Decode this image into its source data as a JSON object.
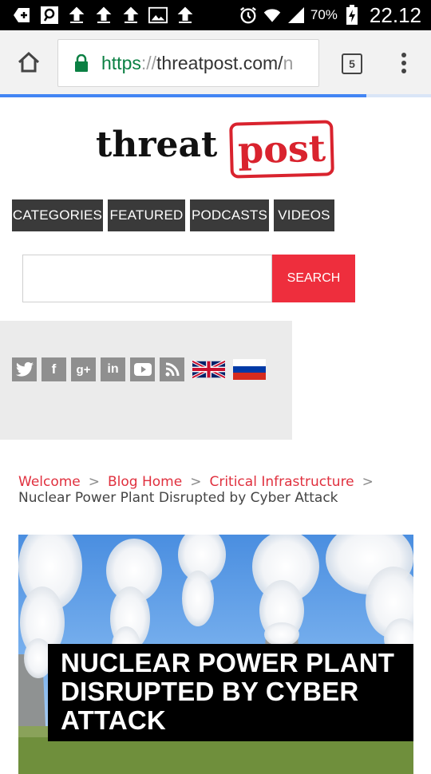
{
  "status_bar": {
    "battery": "70%",
    "time": "22.12"
  },
  "browser": {
    "url_scheme": "https",
    "url_sep": "://",
    "url_host": "threatpost.com/",
    "url_tail": "n",
    "tab_count": "5",
    "load_progress": 0.85
  },
  "logo": {
    "part1": "threat",
    "part2": "post"
  },
  "nav": {
    "items": [
      "CATEGORIES",
      "FEATURED",
      "PODCASTS",
      "VIDEOS"
    ]
  },
  "search": {
    "placeholder": "",
    "button_label": "SEARCH"
  },
  "social": {
    "icons": [
      "twitter-icon",
      "facebook-icon",
      "google-plus-icon",
      "linkedin-icon",
      "youtube-icon",
      "rss-icon"
    ],
    "flags": [
      "uk-flag",
      "russia-flag"
    ]
  },
  "breadcrumb": {
    "items": [
      "Welcome",
      "Blog Home",
      "Critical Infrastructure"
    ],
    "separator": ">",
    "current": "Nuclear Power Plant Disrupted by Cyber Attack"
  },
  "article": {
    "headline": "NUCLEAR POWER PLANT DISRUPTED BY CYBER ATTACK"
  },
  "colors": {
    "accent": "#ee2e3d",
    "nav_bg": "#3a3a3a",
    "link": "#e0303e"
  }
}
